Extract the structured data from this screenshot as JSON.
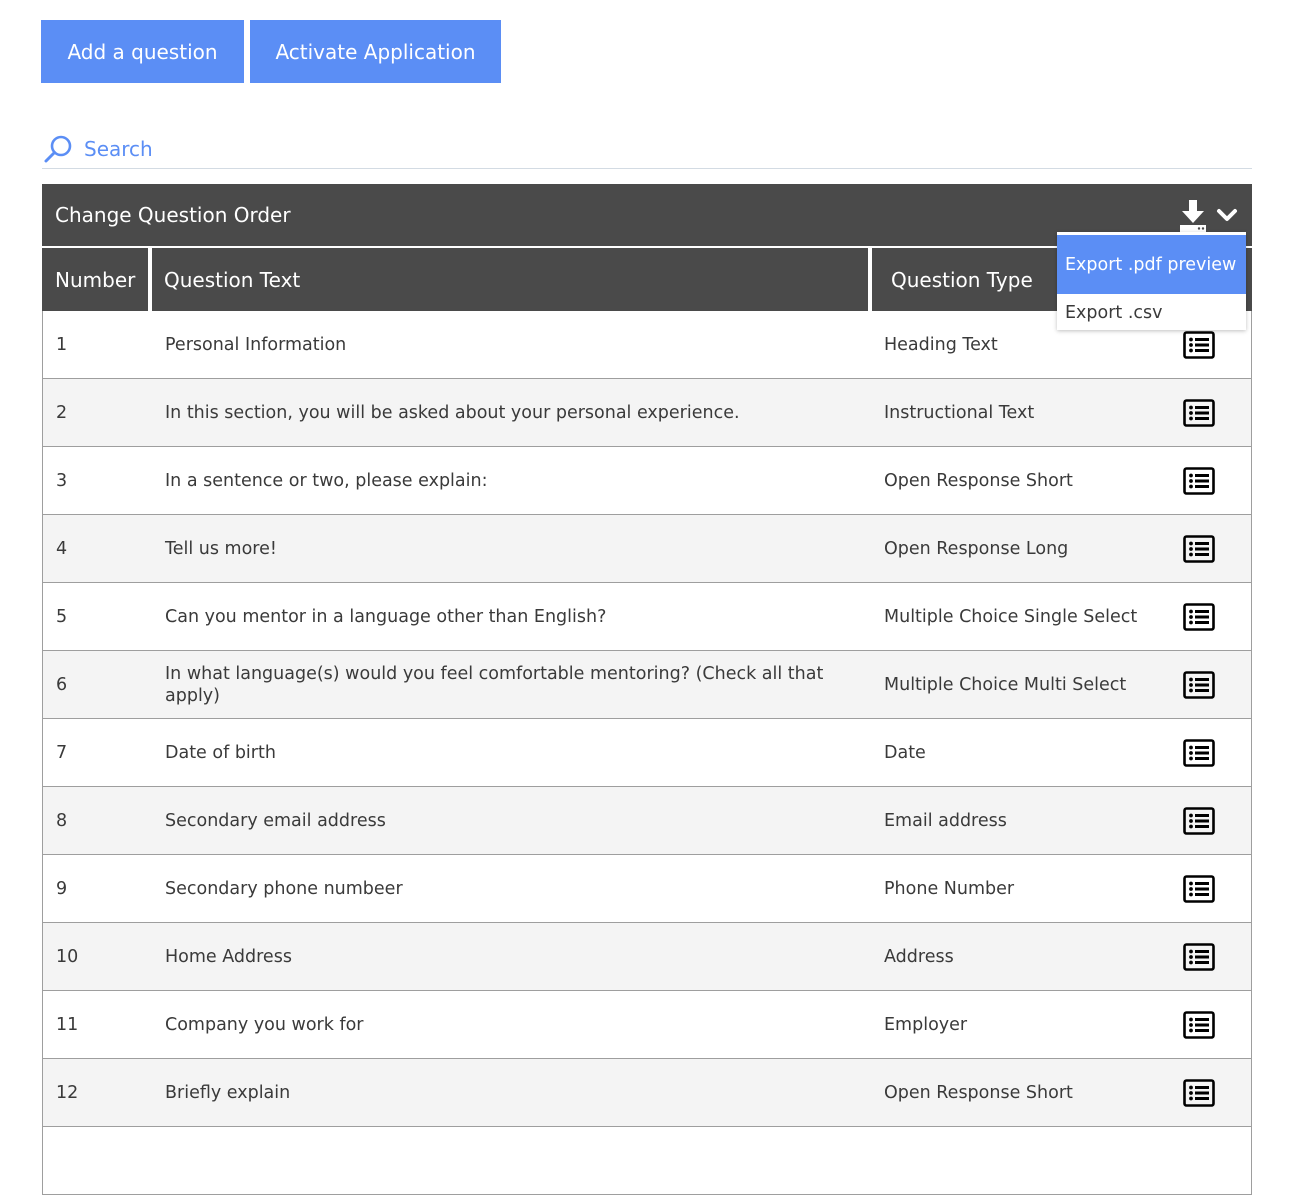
{
  "toolbar": {
    "add_question": "Add a question",
    "activate_application": "Activate Application"
  },
  "search": {
    "placeholder": "Search"
  },
  "panel": {
    "title": "Change Question Order"
  },
  "table": {
    "columns": {
      "number": "Number",
      "question_text": "Question Text",
      "question_type": "Question Type"
    },
    "rows": [
      {
        "number": "1",
        "text": "Personal Information",
        "type": "Heading Text"
      },
      {
        "number": "2",
        "text": "In this section, you will be asked about your personal experience.",
        "type": "Instructional Text"
      },
      {
        "number": "3",
        "text": "In a sentence or two, please explain:",
        "type": "Open Response Short"
      },
      {
        "number": "4",
        "text": "Tell us more!",
        "type": "Open Response Long"
      },
      {
        "number": "5",
        "text": "Can you mentor in a language other than English?",
        "type": "Multiple Choice Single Select"
      },
      {
        "number": "6",
        "text": "In what language(s) would you feel comfortable mentoring? (Check all that apply)",
        "type": "Multiple Choice Multi Select"
      },
      {
        "number": "7",
        "text": "Date of birth",
        "type": "Date"
      },
      {
        "number": "8",
        "text": "Secondary email address",
        "type": "Email address"
      },
      {
        "number": "9",
        "text": "Secondary phone numbeer",
        "type": "Phone Number"
      },
      {
        "number": "10",
        "text": "Home Address",
        "type": "Address"
      },
      {
        "number": "11",
        "text": "Company you work for",
        "type": "Employer"
      },
      {
        "number": "12",
        "text": "Briefly explain",
        "type": "Open Response Short"
      },
      {
        "number": "",
        "text": "",
        "type": ""
      }
    ]
  },
  "export_menu": {
    "items": [
      "Export .pdf preview",
      "Export .csv"
    ]
  },
  "colors": {
    "accent": "#5b8ef5",
    "header_bg": "#4a4a4a",
    "row_alt": "#f4f4f4"
  },
  "icons": {
    "search": "search-icon",
    "download": "download-icon",
    "chevron": "chevron-down-icon",
    "details": "list-details-icon"
  }
}
